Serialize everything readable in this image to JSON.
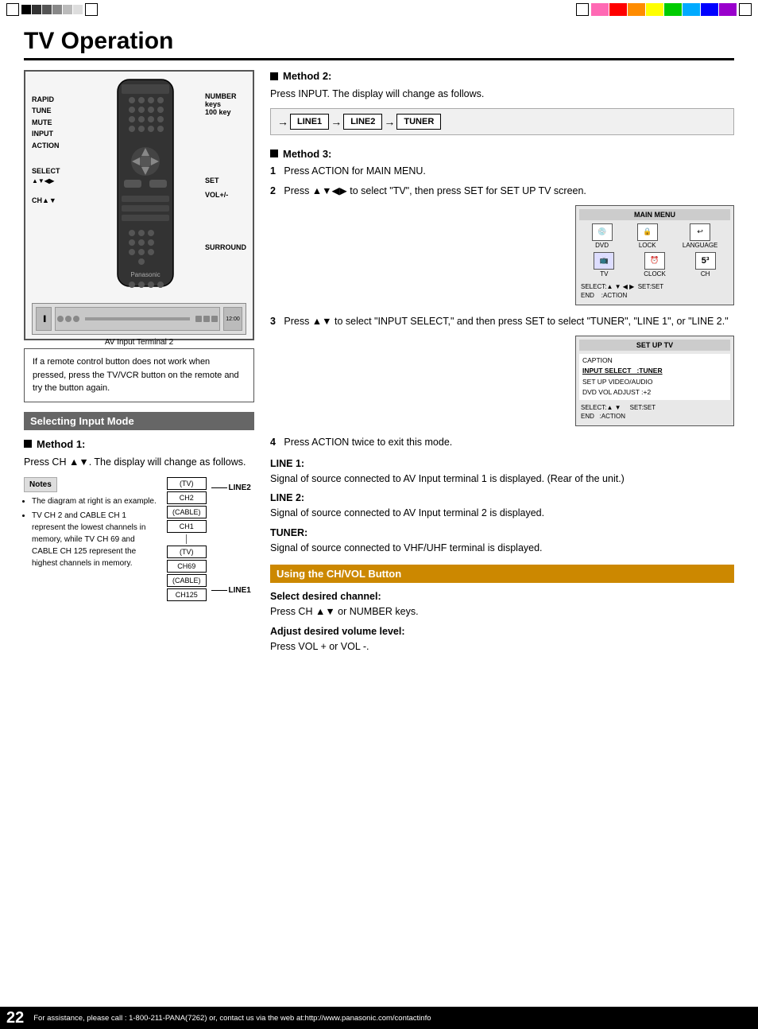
{
  "page": {
    "title": "TV Operation",
    "page_number": "22",
    "footer_text": "For assistance, please call : 1-800-211-PANA(7262) or, contact us via the web at:http://www.panasonic.com/contactinfo"
  },
  "remote_labels": {
    "rapid": "RAPID",
    "tune": "TUNE",
    "mute": "MUTE",
    "input": "INPUT",
    "action": "ACTION",
    "select": "SELECT",
    "select_arrows": "▲▼◀▶",
    "ch": "CH▲▼",
    "number_keys": "NUMBER",
    "keys": "keys",
    "key100": "100 key",
    "set": "SET",
    "vol": "VOL+/-",
    "surround": "SURROUND"
  },
  "av_input_label": "AV Input Terminal 2",
  "notice_box": {
    "text": "If a remote control button does not work when pressed, press the TV/VCR button on the remote and try the button again."
  },
  "selecting_input_mode": {
    "heading": "Selecting Input Mode",
    "method1": {
      "heading": "Method 1:",
      "desc": "Press CH ▲▼. The display will change as follows."
    },
    "notes": {
      "label": "Notes",
      "items": [
        "The diagram at right is an example.",
        "TV CH 2 and CABLE CH 1 represent the lowest channels in memory, while TV CH 69 and CABLE CH 125 represent the highest channels in memory."
      ]
    },
    "ch_diagram": {
      "boxes_top": [
        "(TV)",
        "CH2",
        "(CABLE)",
        "CH1"
      ],
      "boxes_bottom": [
        "(TV)",
        "CH69",
        "(CABLE)",
        "CH125"
      ],
      "line1": "LINE2",
      "line2": "LINE1"
    }
  },
  "method2": {
    "heading": "Method 2:",
    "desc": "Press INPUT. The display will change as follows.",
    "flow": [
      "LINE1",
      "LINE2",
      "TUNER"
    ]
  },
  "method3": {
    "heading": "Method 3:",
    "step1_label": "1",
    "step1_text": "Press ACTION for MAIN MENU.",
    "step2_label": "2",
    "step2_text": "Press ▲▼◀▶ to select \"TV\", then press SET for SET UP TV screen.",
    "main_menu": {
      "title": "MAIN MENU",
      "items": [
        "DVD",
        "LOCK",
        "LANGUAGE",
        "TV",
        "CLOCK",
        "CH"
      ],
      "bottom": "SELECT:▲ ▼ ◀ ▶   SET:SET\nEND    :ACTION"
    },
    "step3_label": "3",
    "step3_text": "Press ▲▼ to select \"INPUT SELECT,\" and then press SET to select \"TUNER\", \"LINE 1\", or \"LINE 2.\"",
    "setup_tv": {
      "title": "SET UP TV",
      "items": [
        "CAPTION",
        "INPUT SELECT   :TUNER",
        "SET UP VIDEO/AUDIO",
        "DVD VOL ADJUST :+2"
      ],
      "highlighted_item": "INPUT SELECT   :TUNER",
      "bottom": "SELECT:▲ ▼     SET:SET\nEND   :ACTION"
    },
    "step4_label": "4",
    "step4_text": "Press ACTION twice to exit this mode."
  },
  "line_descriptions": {
    "line1_label": "LINE 1:",
    "line1_text": "Signal of source connected to AV Input terminal 1 is displayed. (Rear of the unit.)",
    "line2_label": "LINE 2:",
    "line2_text": "Signal of source connected to AV Input terminal 2 is displayed.",
    "tuner_label": "TUNER:",
    "tuner_text": "Signal of source connected to VHF/UHF terminal is displayed."
  },
  "ch_vol_section": {
    "heading": "Using the CH/VOL Button",
    "select_channel_label": "Select desired channel:",
    "select_channel_text": "Press CH ▲▼ or NUMBER keys.",
    "adjust_volume_label": "Adjust desired volume level:",
    "adjust_volume_text": "Press VOL + or VOL -."
  },
  "colors": {
    "section_header_bg": "#666666",
    "section_header_orange": "#cc8800",
    "black": "#000000",
    "white": "#ffffff"
  }
}
